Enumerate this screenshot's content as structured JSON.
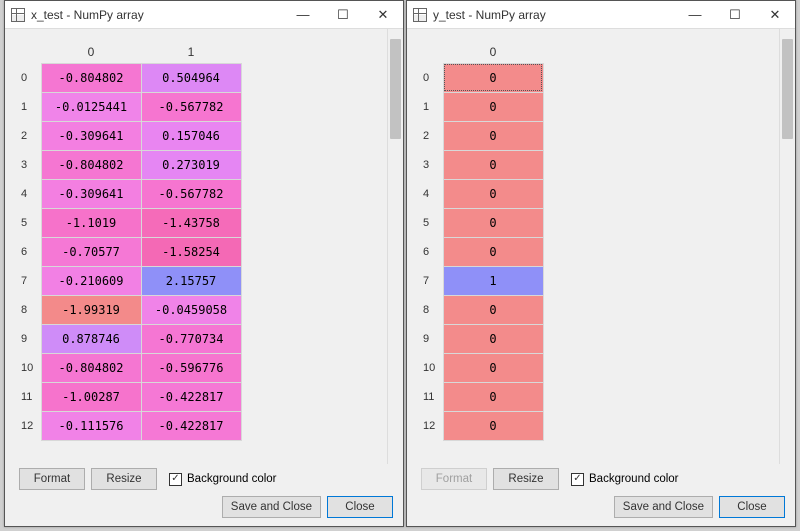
{
  "left": {
    "title": "x_test - NumPy array",
    "columns": [
      "0",
      "1"
    ],
    "rows": [
      {
        "idx": "0",
        "c0": {
          "v": "-0.804802",
          "bg": "#f576d2"
        },
        "c1": {
          "v": "0.504964",
          "bg": "#dd88f5"
        }
      },
      {
        "idx": "1",
        "c0": {
          "v": "-0.0125441",
          "bg": "#f084e9"
        },
        "c1": {
          "v": "-0.567782",
          "bg": "#f675d0"
        }
      },
      {
        "idx": "2",
        "c0": {
          "v": "-0.309641",
          "bg": "#f37fe1"
        },
        "c1": {
          "v": "0.157046",
          "bg": "#e985f1"
        }
      },
      {
        "idx": "3",
        "c0": {
          "v": "-0.804802",
          "bg": "#f576d2"
        },
        "c1": {
          "v": "0.273019",
          "bg": "#e586f3"
        }
      },
      {
        "idx": "4",
        "c0": {
          "v": "-0.309641",
          "bg": "#f37fe1"
        },
        "c1": {
          "v": "-0.567782",
          "bg": "#f675d0"
        }
      },
      {
        "idx": "5",
        "c0": {
          "v": "-1.1019",
          "bg": "#f672ca"
        },
        "c1": {
          "v": "-1.43758",
          "bg": "#f56bb9"
        }
      },
      {
        "idx": "6",
        "c0": {
          "v": "-0.70577",
          "bg": "#f578d5"
        },
        "c1": {
          "v": "-1.58254",
          "bg": "#f469b5"
        }
      },
      {
        "idx": "7",
        "c0": {
          "v": "-0.210609",
          "bg": "#f280e4"
        },
        "c1": {
          "v": "2.15757",
          "bg": "#8f90f8"
        }
      },
      {
        "idx": "8",
        "c0": {
          "v": "-1.99319",
          "bg": "#f38a8a"
        },
        "c1": {
          "v": "-0.0459058",
          "bg": "#f083e8"
        }
      },
      {
        "idx": "9",
        "c0": {
          "v": "0.878746",
          "bg": "#cf8cf8"
        },
        "c1": {
          "v": "-0.770734",
          "bg": "#f576d3"
        }
      },
      {
        "idx": "10",
        "c0": {
          "v": "-0.804802",
          "bg": "#f576d2"
        },
        "c1": {
          "v": "-0.596776",
          "bg": "#f675cf"
        }
      },
      {
        "idx": "11",
        "c0": {
          "v": "-1.00287",
          "bg": "#f673cc"
        },
        "c1": {
          "v": "-0.422817",
          "bg": "#f578d5"
        }
      },
      {
        "idx": "12",
        "c0": {
          "v": "-0.111576",
          "bg": "#f182e7"
        },
        "c1": {
          "v": "-0.422817",
          "bg": "#f578d5"
        }
      }
    ],
    "buttons": {
      "format": "Format",
      "resize": "Resize",
      "save_close": "Save and Close",
      "close": "Close"
    },
    "bg_checkbox": {
      "label": "Background color",
      "checked": true
    },
    "format_disabled": false
  },
  "right": {
    "title": "y_test - NumPy array",
    "columns": [
      "0"
    ],
    "rows": [
      {
        "idx": "0",
        "c0": {
          "v": "0",
          "bg": "#f38b8b"
        }
      },
      {
        "idx": "1",
        "c0": {
          "v": "0",
          "bg": "#f38b8b"
        }
      },
      {
        "idx": "2",
        "c0": {
          "v": "0",
          "bg": "#f38b8b"
        }
      },
      {
        "idx": "3",
        "c0": {
          "v": "0",
          "bg": "#f38b8b"
        }
      },
      {
        "idx": "4",
        "c0": {
          "v": "0",
          "bg": "#f38b8b"
        }
      },
      {
        "idx": "5",
        "c0": {
          "v": "0",
          "bg": "#f38b8b"
        }
      },
      {
        "idx": "6",
        "c0": {
          "v": "0",
          "bg": "#f38b8b"
        }
      },
      {
        "idx": "7",
        "c0": {
          "v": "1",
          "bg": "#8f90f8"
        }
      },
      {
        "idx": "8",
        "c0": {
          "v": "0",
          "bg": "#f38b8b"
        }
      },
      {
        "idx": "9",
        "c0": {
          "v": "0",
          "bg": "#f38b8b"
        }
      },
      {
        "idx": "10",
        "c0": {
          "v": "0",
          "bg": "#f38b8b"
        }
      },
      {
        "idx": "11",
        "c0": {
          "v": "0",
          "bg": "#f38b8b"
        }
      },
      {
        "idx": "12",
        "c0": {
          "v": "0",
          "bg": "#f38b8b"
        }
      }
    ],
    "buttons": {
      "format": "Format",
      "resize": "Resize",
      "save_close": "Save and Close",
      "close": "Close"
    },
    "bg_checkbox": {
      "label": "Background color",
      "checked": true
    },
    "format_disabled": true
  },
  "win_controls": {
    "min": "—",
    "max": "☐",
    "close": "✕"
  }
}
